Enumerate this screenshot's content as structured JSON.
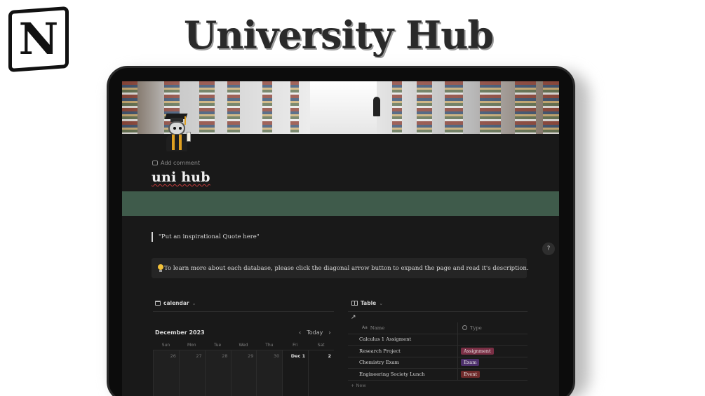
{
  "brand": {
    "logo_letter": "N",
    "icon": "notion-logo-icon"
  },
  "headline": "University Hub",
  "page": {
    "add_comment": "Add comment",
    "title": "uni hub",
    "quote": "\"Put an inspirational Quote here\"",
    "help_label": "?",
    "callout": {
      "icon": "lightbulb-icon",
      "text": "To learn more about each database, please click the diagonal arrow button to expand the page and read it's description."
    }
  },
  "calendar": {
    "view_name": "calendar",
    "month_label": "December 2023",
    "today_label": "Today",
    "prev_label": "‹",
    "next_label": "›",
    "weekdays": [
      "Sun",
      "Mon",
      "Tue",
      "Wed",
      "Thu",
      "Fri",
      "Sat"
    ],
    "first_week": [
      "26",
      "27",
      "28",
      "29",
      "30",
      "Dec 1",
      "2"
    ]
  },
  "table": {
    "view_name": "Table",
    "columns": {
      "name": "Name",
      "type": "Type",
      "name_prefix": "Aa"
    },
    "rows": [
      {
        "name": "Calculus 1 Assigment",
        "type": ""
      },
      {
        "name": "Research Project",
        "type": "Assignment",
        "color": "#7a2f45"
      },
      {
        "name": "Chemistry Exam",
        "type": "Exam",
        "color": "#4c2f6b"
      },
      {
        "name": "Engineering Society Lunch",
        "type": "Event",
        "color": "#6e2b2b"
      }
    ],
    "new_label": "New"
  },
  "colors": {
    "band": "#3f5b4b",
    "background": "#191919"
  }
}
